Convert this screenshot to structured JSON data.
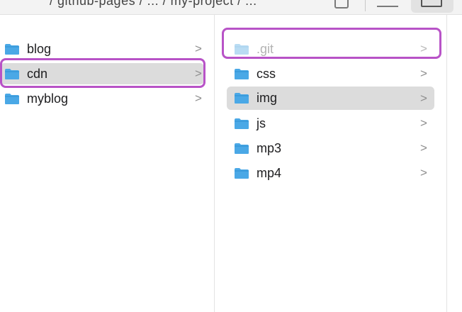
{
  "toolbar": {
    "path_text": "/ github-pages / ... / my-project / ..."
  },
  "columns": [
    {
      "items": [
        {
          "label": "blog",
          "selected": false,
          "dim": false
        },
        {
          "label": "cdn",
          "selected": true,
          "dim": false
        },
        {
          "label": "myblog",
          "selected": false,
          "dim": false
        }
      ]
    },
    {
      "items": [
        {
          "label": ".git",
          "selected": false,
          "dim": true
        },
        {
          "label": "css",
          "selected": false,
          "dim": false
        },
        {
          "label": "img",
          "selected": true,
          "dim": false
        },
        {
          "label": "js",
          "selected": false,
          "dim": false
        },
        {
          "label": "mp3",
          "selected": false,
          "dim": false
        },
        {
          "label": "mp4",
          "selected": false,
          "dim": false
        }
      ]
    }
  ],
  "chevron": ">",
  "colors": {
    "folder": "#4aa8e6",
    "folder_dim": "#b9dcf3",
    "selection": "#dcdcdc",
    "highlight": "#b853c7"
  },
  "icons": {
    "folder": "folder-icon",
    "chevron": "chevron-right-icon"
  }
}
